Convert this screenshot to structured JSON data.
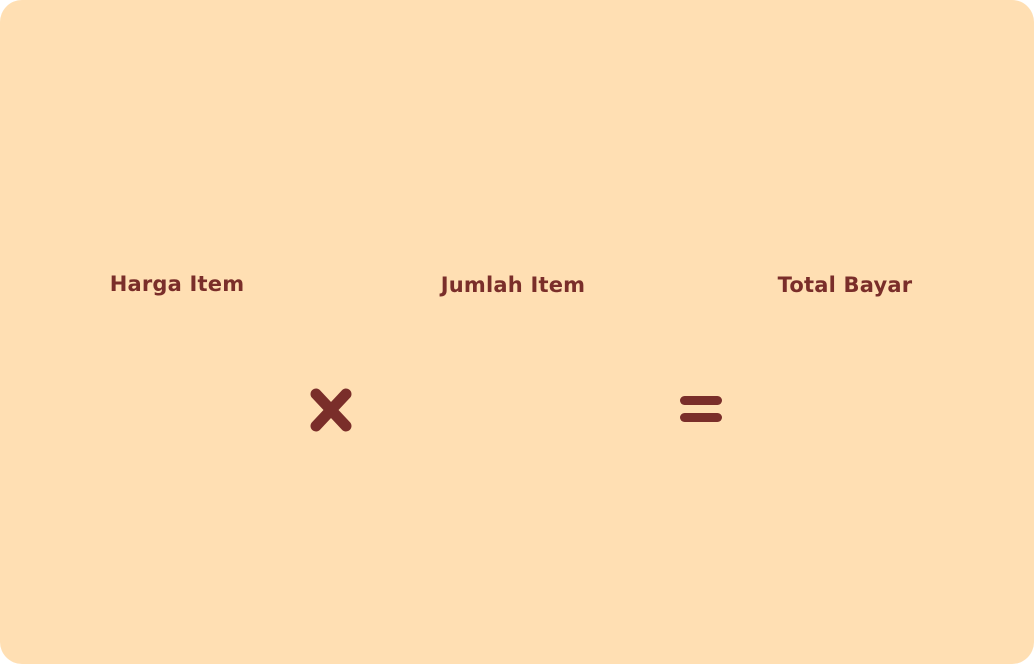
{
  "colors": {
    "background": "#FFDFB3",
    "text": "#7A2E2A"
  },
  "labels": {
    "harga_item": "Harga Item",
    "jumlah_item": "Jumlah Item",
    "total_bayar": "Total Bayar"
  },
  "icons": {
    "times": "multiply-icon",
    "equals": "equals-icon"
  }
}
